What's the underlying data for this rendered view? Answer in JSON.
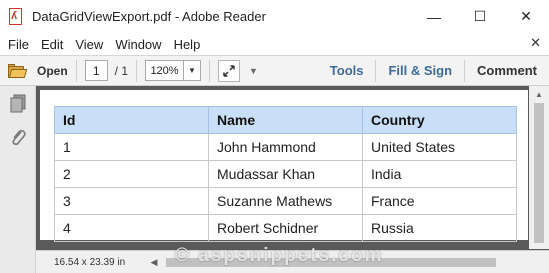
{
  "window": {
    "title": "DataGridViewExport.pdf - Adobe Reader",
    "controls": {
      "minimize": "—",
      "maximize": "☐",
      "close": "✕"
    }
  },
  "menu": {
    "items": [
      "File",
      "Edit",
      "View",
      "Window",
      "Help"
    ],
    "close_doc": "✕"
  },
  "toolbar": {
    "open_label": "Open",
    "current_page": "1",
    "page_count": "/ 1",
    "zoom": "120%",
    "tools_label": "Tools",
    "fill_sign_label": "Fill & Sign",
    "comment_label": "Comment"
  },
  "document": {
    "table": {
      "headers": [
        "Id",
        "Name",
        "Country"
      ],
      "rows": [
        [
          "1",
          "John Hammond",
          "United States"
        ],
        [
          "2",
          "Mudassar Khan",
          "India"
        ],
        [
          "3",
          "Suzanne Mathews",
          "France"
        ],
        [
          "4",
          "Robert Schidner",
          "Russia"
        ]
      ]
    }
  },
  "status": {
    "page_size": "16.54 x 23.39 in"
  },
  "watermark": "© aspsnippets.com",
  "colors": {
    "header_bg": "#c9def7",
    "link_blue": "#3d6c9c",
    "doc_bg": "#5a5a5a",
    "pdf_red": "#d0312d"
  },
  "icons": {
    "app": "pdf-file-icon",
    "open": "folder-icon",
    "fit": "expand-arrows-icon",
    "nav_pages": "page-thumbnails-icon",
    "nav_attach": "paperclip-icon"
  }
}
